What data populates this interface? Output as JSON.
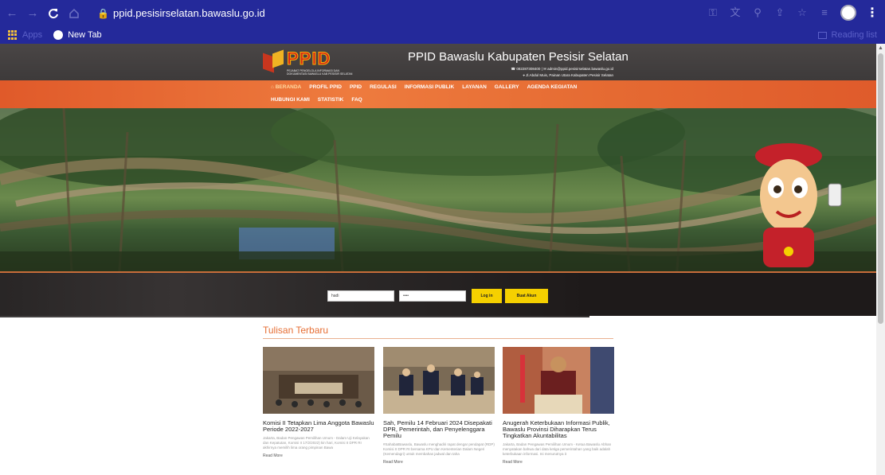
{
  "browser": {
    "url": "ppid.pesisirselatan.bawaslu.go.id",
    "bookmark_apps": "Apps",
    "bookmark_newtab": "New Tab",
    "reading_list": "Reading list"
  },
  "header": {
    "logo_text": "PPID",
    "logo_sub": "PEJABAT PENGELOLA INFORMASI DAN DOKUMENTASI BAWASLU KAB PESISIR SELATAN",
    "title": "PPID Bawaslu Kabupaten Pesisir Selatan",
    "contact_line": "☎ 082287308400 | ✉ admin@ppid.pesisirselatan.bawaslu.go.id",
    "address_line": "⌖ Jl.Abdul Muis, Painan Utara Kabupaten Pesisir Selatan"
  },
  "menu": {
    "row1": [
      "BERANDA",
      "PROFIL PPID",
      "PPID",
      "REGULASI",
      "INFORMASI PUBLIK",
      "LAYANAN",
      "GALLERY",
      "AGENDA KEGIATAN"
    ],
    "row2": [
      "HUBUNGI KAMI",
      "STATISTIK",
      "FAQ"
    ]
  },
  "login": {
    "username_value": "hadi",
    "password_value": "••••",
    "login_label": "Log in",
    "register_label": "Buat Akun"
  },
  "news": {
    "section_title": "Tulisan Terbaru",
    "read_more": "Read More",
    "items": [
      {
        "title": "Komisi II Tetapkan Lima Anggota Bawaslu Periode 2022-2027",
        "excerpt": "Jakarta, Badan Pengawas Pemilihan Umum - Dalam Uji Kelayakan dan Kepatutan, Komisi II 17/2/2022) kin hari, Komisi II DPR RI akhirnya memilih lima orang pimpinan Bawa"
      },
      {
        "title": "Sah, Pemilu 14 Februari 2024 Disepakati DPR, Pemerintah, dan Penyelenggara Pemilu",
        "excerpt": "#SahabatBawaslu, Bawaslu menghadiri rapat dengar pendapat (RDP) Komisi II DPR RI bersama KPU dan Kementerian Dalam Negeri (Kemendagri) untuk membahas jadwal dan taha"
      },
      {
        "title": "Anugerah Keterbukaan Informasi Publik, Bawaslu Provinsi Diharapkan Terus Tingkatkan Akuntabilitas",
        "excerpt": "Jakarta, Badan Pengawas Pemilihan Umum - Ketua Bawaslu Abhan menyatakan bahwa dari data ketiga pemerintahan yang baik adalah keterbukaan informasi. Ini menurutnya it"
      }
    ]
  }
}
